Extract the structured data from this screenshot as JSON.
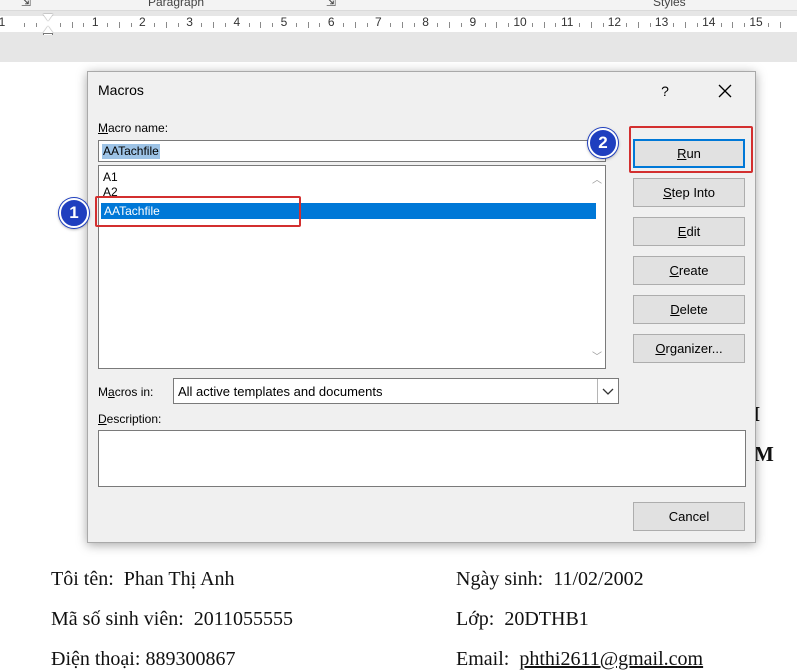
{
  "ribbon": {
    "paragraph_label": "Paragraph",
    "styles_label": "Styles"
  },
  "ruler": {
    "numbers": [
      "1",
      "1",
      "2",
      "3",
      "4",
      "5",
      "6",
      "7",
      "8",
      "9",
      "10",
      "11",
      "12",
      "13",
      "14",
      "15"
    ]
  },
  "dialog": {
    "title": "Macros",
    "help": "?",
    "macro_name_label": "Macro name:",
    "macro_name_value": "AATachfile",
    "macro_list": [
      "A1",
      "A2",
      "AATachfile"
    ],
    "selected_macro": "AATachfile",
    "macros_in_label": "Macros in:",
    "macros_in_value": "All active templates and documents",
    "description_label": "Description:",
    "buttons": {
      "run": "Run",
      "step_into": "Step Into",
      "edit": "Edit",
      "create": "Create",
      "delete": "Delete",
      "organizer": "Organizer...",
      "cancel": "Cancel"
    }
  },
  "annotations": {
    "badge_1": "1",
    "badge_2": "2",
    "highlight_color": "#d32f2f",
    "badge_color": "#1f3fbf"
  },
  "document": {
    "name_label": "Tôi tên:  ",
    "name_value": "Phan Thị Anh",
    "student_id_label": "Mã số sinh viên:  ",
    "student_id_value": "2011055555",
    "phone_label": "Điện thoại: ",
    "phone_value": "889300867",
    "dob_label": "Ngày sinh:  ",
    "dob_value": "11/02/2002",
    "class_label": "Lớp:  ",
    "class_value": "20DTHB1",
    "email_label": "Email:  ",
    "email_value": "phthi2611@gmail.com",
    "partial_heading_1": "I",
    "partial_heading_2": "M"
  },
  "colors": {
    "selection": "#0078d7",
    "dialog_bg": "#f0f0f0"
  }
}
